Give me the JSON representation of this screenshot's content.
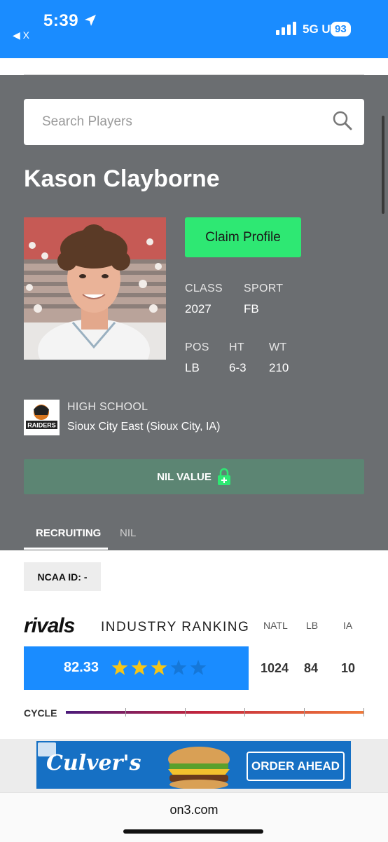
{
  "status": {
    "time": "5:39",
    "back": "◀ X",
    "network": "5G UW",
    "battery": "93"
  },
  "search": {
    "placeholder": "Search Players"
  },
  "player": {
    "name": "Kason Clayborne",
    "claim_label": "Claim Profile",
    "class_label": "CLASS",
    "class_value": "2027",
    "sport_label": "SPORT",
    "sport_value": "FB",
    "pos_label": "POS",
    "pos_value": "LB",
    "ht_label": "HT",
    "ht_value": "6-3",
    "wt_label": "WT",
    "wt_value": "210",
    "school_label": "HIGH SCHOOL",
    "school_value": "Sioux City East (Sioux City, IA)",
    "school_logo_text": "RAIDERS"
  },
  "nil": {
    "label": "NIL VALUE"
  },
  "tabs": [
    {
      "label": "RECRUITING"
    },
    {
      "label": "NIL"
    }
  ],
  "ncaa": {
    "label": "NCAA ID:  -"
  },
  "ranking": {
    "brand": "rivals",
    "title": "INDUSTRY RANKING",
    "headers": [
      "NATL",
      "LB",
      "IA"
    ],
    "rating": "82.33",
    "stars_filled": 3,
    "stars_total": 5,
    "values": [
      "1024",
      "84",
      "10"
    ],
    "cycle_label": "CYCLE"
  },
  "ad": {
    "brand": "Culver's",
    "cta": "ORDER AHEAD"
  },
  "browser": {
    "url": "on3.com"
  },
  "colors": {
    "accent": "#1a8cff",
    "claim": "#2ee873",
    "nil_bar": "#5c8573",
    "panel": "#6b6e71"
  }
}
